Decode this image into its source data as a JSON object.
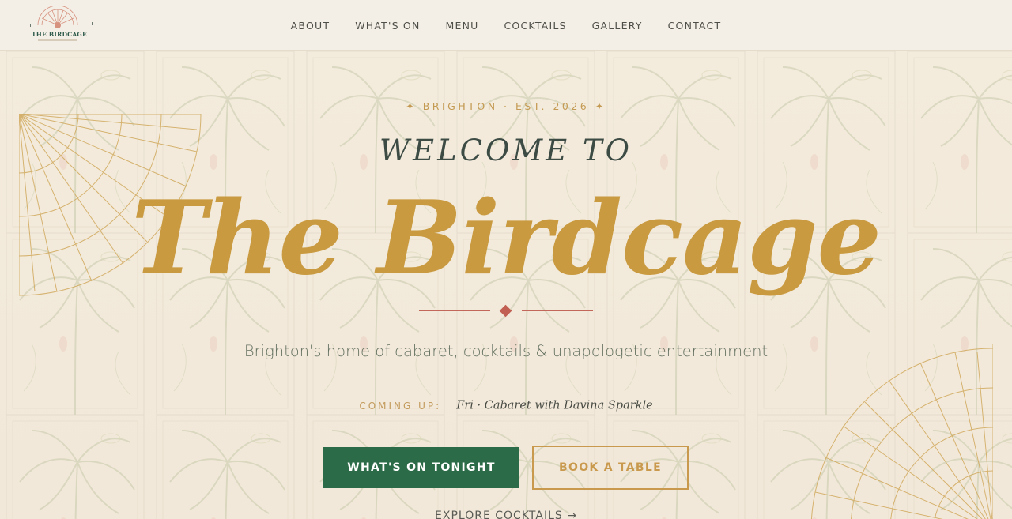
{
  "header": {
    "logo_text": "THE BIRDCAGE",
    "nav": [
      "ABOUT",
      "WHAT'S ON",
      "MENU",
      "COCKTAILS",
      "GALLERY",
      "CONTACT"
    ]
  },
  "hero": {
    "tagline": "✦ BRIGHTON · EST. 2026 ✦",
    "welcome": "WELCOME TO",
    "title": "The Birdcage",
    "subtitle": "Brighton's home of cabaret, cocktails & unapologetic entertainment",
    "coming_up_label": "COMING UP:",
    "coming_up_event": "Fri · Cabaret with Davina Sparkle",
    "primary_button": "WHAT'S ON TONIGHT",
    "secondary_button": "BOOK A TABLE",
    "explore_link": "EXPLORE COCKTAILS →"
  },
  "colors": {
    "accent_gold": "#c99a3f",
    "primary_green": "#2c6b48",
    "divider_red": "#c05f52",
    "background": "#f3ebdc"
  }
}
